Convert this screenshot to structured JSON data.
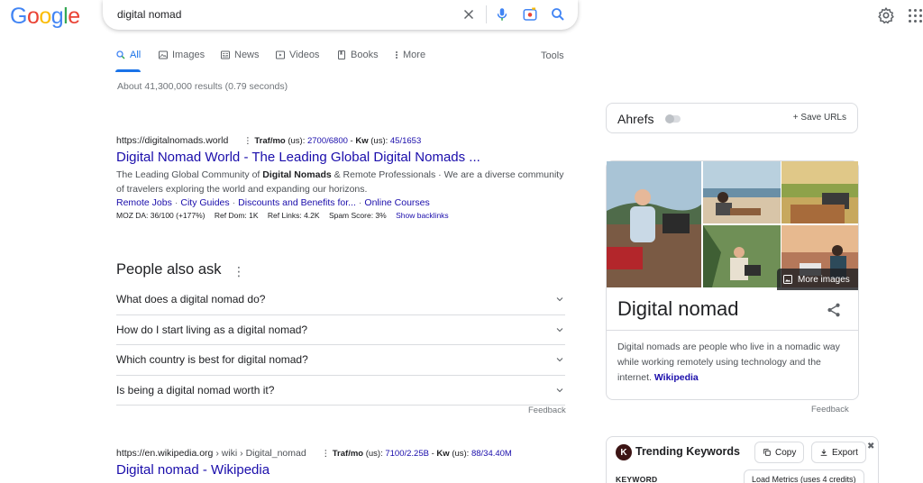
{
  "logo": {
    "text": "Google"
  },
  "search": {
    "query": "digital nomad",
    "placeholder": ""
  },
  "tabs": [
    {
      "label": "All"
    },
    {
      "label": "Images"
    },
    {
      "label": "News"
    },
    {
      "label": "Videos"
    },
    {
      "label": "Books"
    },
    {
      "label": "More"
    }
  ],
  "tools_label": "Tools",
  "result_stats": "About 41,300,000 results (0.79 seconds)",
  "results": [
    {
      "url": "https://digitalnomads.world",
      "traffic_label": "Traf/mo",
      "traffic_region": "(us):",
      "traffic_value": "2700/6800",
      "kw_label": "Kw",
      "kw_region": "(us):",
      "kw_value": "45/1653",
      "title": "Digital Nomad World - The Leading Global Digital Nomads ...",
      "snippet_1": "The Leading Global Community of ",
      "snippet_bold_1": "Digital Nomads",
      "snippet_2": " & Remote Professionals · We are a diverse community of travelers exploring the world and expanding our horizons.",
      "sitelinks": [
        "Remote Jobs",
        "City Guides",
        "Discounts and Benefits for...",
        "Online Courses"
      ],
      "moz": {
        "da": "MOZ DA: 36/100 (+177%)",
        "ref_dom": "Ref Dom: 1K",
        "ref_links": "Ref Links: 4.2K",
        "spam": "Spam Score: 3%",
        "backlinks": "Show backlinks"
      }
    },
    {
      "url": "https://en.wikipedia.org",
      "breadcrumb": " › wiki › Digital_nomad",
      "traffic_label": "Traf/mo",
      "traffic_region": "(us):",
      "traffic_value": "7100/2.25B",
      "kw_label": "Kw",
      "kw_region": "(us):",
      "kw_value": "88/34.40M",
      "title": "Digital nomad - Wikipedia"
    }
  ],
  "paa": {
    "title": "People also ask",
    "questions": [
      "What does a digital nomad do?",
      "How do I start living as a digital nomad?",
      "Which country is best for digital nomad?",
      "Is being a digital nomad worth it?"
    ],
    "feedback": "Feedback"
  },
  "ahrefs": {
    "name": "Ahrefs",
    "save_label": "Save URLs"
  },
  "knowledge_panel": {
    "more_images": "More images",
    "title": "Digital nomad",
    "description": "Digital nomads are people who live in a nomadic way while working remotely using technology and the internet. ",
    "source": "Wikipedia",
    "feedback": "Feedback"
  },
  "trending": {
    "logo": "K",
    "title": "Trending Keywords",
    "copy": "Copy",
    "export": "Export",
    "keyword_header": "KEYWORD",
    "load_metrics": "Load Metrics (uses 4 credits)"
  },
  "colors": {
    "link": "#1a0dab",
    "accent": "#1a73e8",
    "google_blue": "#4285f4",
    "google_red": "#ea4335",
    "google_yellow": "#fbbc05",
    "google_green": "#34a853"
  }
}
